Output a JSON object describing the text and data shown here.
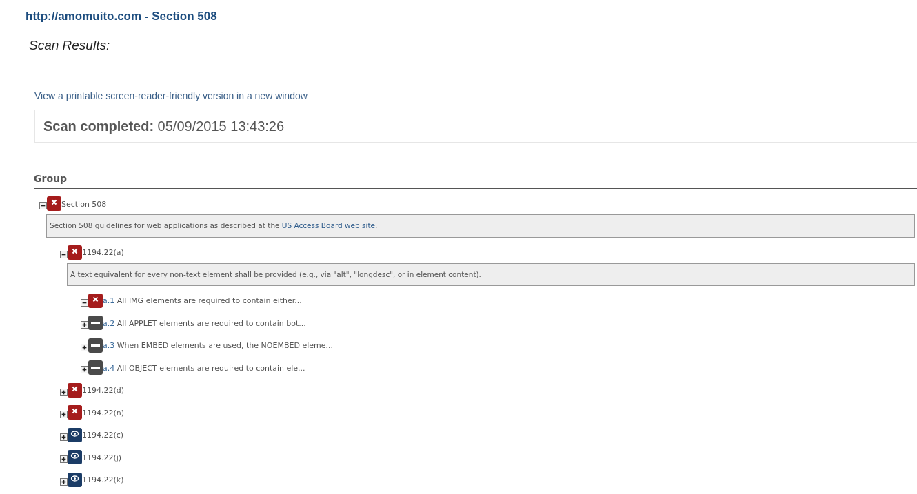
{
  "title": "http://amomuito.com - Section 508",
  "subtitle": "Scan Results:",
  "printable_link": "View a printable screen-reader-friendly version in a new window",
  "scan_completed": {
    "label": "Scan completed:",
    "value": "05/09/2015 13:43:26"
  },
  "table": {
    "columns": [
      "Group"
    ]
  },
  "tree": [
    {
      "label": "Section 508",
      "kind": "fail",
      "expanded": true,
      "description": {
        "text": "Section 508 guidelines for web applications as described at the ",
        "link": "US Access Board web site",
        "after": "."
      },
      "children": [
        {
          "label": "1194.22(a)",
          "kind": "fail",
          "expanded": true,
          "description": {
            "text": "A text equivalent for every non-text element shall be provided (e.g., via \"alt\", \"longdesc\", or in element content)."
          },
          "children": [
            {
              "code": "a.1",
              "label": "All IMG elements are required to contain either...",
              "kind": "fail",
              "expanded": true
            },
            {
              "code": "a.2",
              "label": "All APPLET elements are required to contain bot...",
              "kind": "unknown",
              "expanded": false
            },
            {
              "code": "a.3",
              "label": "When EMBED elements are used, the NOEMBED eleme...",
              "kind": "unknown",
              "expanded": false
            },
            {
              "code": "a.4",
              "label": "All OBJECT elements are required to contain ele...",
              "kind": "unknown",
              "expanded": false
            }
          ]
        },
        {
          "label": "1194.22(d)",
          "kind": "fail",
          "expanded": false
        },
        {
          "label": "1194.22(n)",
          "kind": "fail",
          "expanded": false
        },
        {
          "label": "1194.22(c)",
          "kind": "review",
          "expanded": false
        },
        {
          "label": "1194.22(j)",
          "kind": "review",
          "expanded": false
        },
        {
          "label": "1194.22(k)",
          "kind": "review",
          "expanded": false
        }
      ]
    }
  ]
}
